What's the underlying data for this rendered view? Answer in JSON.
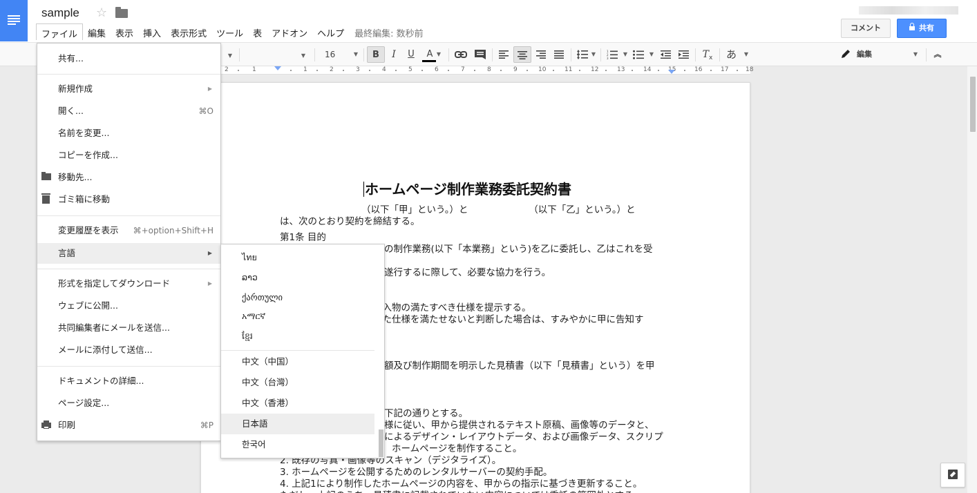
{
  "header": {
    "doc_title": "sample",
    "menu": [
      "ファイル",
      "編集",
      "表示",
      "挿入",
      "表示形式",
      "ツール",
      "表",
      "アドオン",
      "ヘルプ"
    ],
    "last_edit": "最終編集: 数秒前",
    "comment_label": "コメント",
    "share_label": "共有"
  },
  "toolbar": {
    "font_size": "16",
    "bold": "B",
    "italic": "I",
    "underline": "U",
    "text_color": "A",
    "input_tools": "あ",
    "edit_mode": "編集"
  },
  "ruler": [
    "2",
    "1",
    "1",
    "2",
    "3",
    "4",
    "5",
    "6",
    "7",
    "8",
    "9",
    "10",
    "11",
    "12",
    "13",
    "14",
    "15",
    "16",
    "17",
    "18"
  ],
  "document": {
    "title": "ホームページ制作業務委託契約書",
    "lines": [
      "（以下「甲」という。）と　　　　　　　（以下「乙」という。）と",
      "は、次のとおり契約を締結する。",
      "第1条  目的",
      "の制作業務(以下「本業務」という)を乙に委託し、乙はこれを受",
      "遂行するに際して、必要な協力を行う。",
      "納入物の満たすべき仕様を提示する。",
      "れた仕様を満たせないと判断した場合は、すみやかに甲に告知す",
      "額及び制作期間を明示した見積書（以下「見積書」という）を甲",
      "下記の通りとする。",
      "様に従い、甲から提供されるテキスト原稿、画像等のデータと、",
      "によるデザイン・レイアウトデータ、および画像データ、スクリプ",
      "ホームページを制作すること。",
      "2.   既存の写真・画像等のスキャン（デジタライズ）。",
      "3.   ホームページを公開するためのレンタルサーバーの契約手配。",
      "4.   上記1により制作したホームページの内容を、甲からの指示に基づき更新すること。",
      "ただし、上記のうち、見積書に記載されていない内容については委託の範囲外とする。"
    ]
  },
  "file_menu": {
    "share": "共有...",
    "new": "新規作成",
    "open": "開く...",
    "open_sc": "⌘O",
    "rename": "名前を変更...",
    "copy": "コピーを作成...",
    "move": "移動先...",
    "trash": "ゴミ箱に移動",
    "history": "変更履歴を表示",
    "history_sc": "⌘+option+Shift+H",
    "language": "言語",
    "download": "形式を指定してダウンロード",
    "publish": "ウェブに公開...",
    "email_collab": "共同編集者にメールを送信...",
    "email_attach": "メールに添付して送信...",
    "details": "ドキュメントの詳細...",
    "page_setup": "ページ設定...",
    "print": "印刷",
    "print_sc": "⌘P"
  },
  "language_menu": [
    "ไทย",
    "ລາວ",
    "ქართული",
    "አማርኛ",
    "ខ្មែរ",
    "中文（中国）",
    "中文（台灣）",
    "中文（香港）",
    "日本語",
    "한국어"
  ],
  "selected_language": "日本語"
}
